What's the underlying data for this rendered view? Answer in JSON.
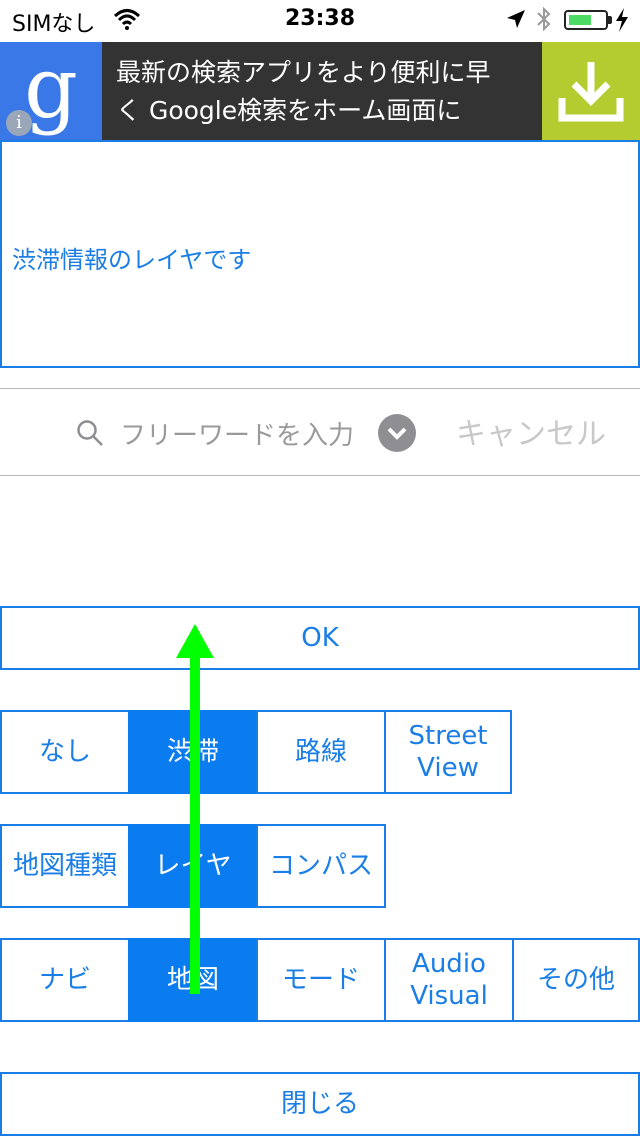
{
  "status_bar": {
    "carrier": "SIMなし",
    "time": "23:38"
  },
  "ad": {
    "logo_letter": "g",
    "info": "i",
    "text_line1": "最新の検索アプリをより便利に早",
    "text_line2": "く Google検索をホーム画面に"
  },
  "layer_info": {
    "text": "渋滞情報のレイヤです"
  },
  "search": {
    "placeholder": "フリーワードを入力",
    "cancel_label": "キャンセル"
  },
  "ok_label": "OK",
  "row1": [
    {
      "label": "なし",
      "selected": false
    },
    {
      "label": "渋滞",
      "selected": true
    },
    {
      "label": "路線",
      "selected": false
    },
    {
      "label": "Street View",
      "selected": false
    }
  ],
  "row2": [
    {
      "label": "地図種類",
      "selected": false
    },
    {
      "label": "レイヤ",
      "selected": true
    },
    {
      "label": "コンパス",
      "selected": false
    }
  ],
  "row3": [
    {
      "label": "ナビ",
      "selected": false
    },
    {
      "label": "地図",
      "selected": true
    },
    {
      "label": "モード",
      "selected": false
    },
    {
      "label": "Audio Visual",
      "selected": false
    },
    {
      "label": "その他",
      "selected": false
    }
  ],
  "close_label": "閉じる",
  "colors": {
    "accent": "#1a7ee6",
    "selected_bg": "#0a7cf0",
    "ad_bg": "#333333",
    "ad_logo_bg": "#3b78e7",
    "ad_download_bg": "#b5cc30",
    "gesture_arrow": "#00ff00"
  },
  "icons": [
    "wifi-icon",
    "location-arrow-icon",
    "bluetooth-icon",
    "battery-icon",
    "charging-icon",
    "google-logo-icon",
    "info-icon",
    "download-icon",
    "search-icon",
    "chevron-down-icon",
    "swipe-up-arrow-icon"
  ]
}
